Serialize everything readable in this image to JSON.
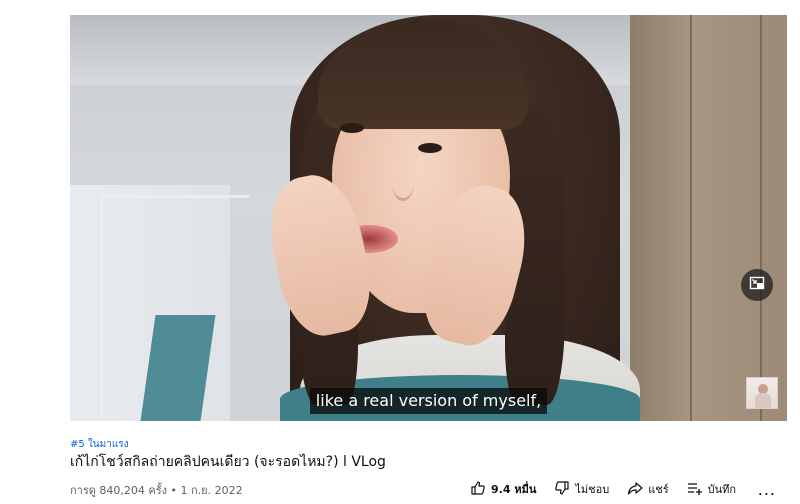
{
  "video": {
    "subtitle": "like a real version of myself,"
  },
  "meta": {
    "hashtag": "#5 ในมาแรง",
    "title": "เก้ไก่โชว์สกิลถ่ายคลิปคนเดียว (จะรอดไหม?) l VLog",
    "stats": "การดู 840,204 ครั้ง • 1 ก.ย. 2022"
  },
  "actions": {
    "like_count": "9.4 หมื่น",
    "dislike_label": "ไม่ชอบ",
    "share_label": "แชร์",
    "save_label": "บันทึก",
    "more_label": "..."
  },
  "icons": {
    "pip": "picture-in-picture-icon",
    "like": "thumbs-up-icon",
    "dislike": "thumbs-down-icon",
    "share": "share-arrow-icon",
    "save": "playlist-add-icon",
    "more": "more-horizontal-icon"
  },
  "colors": {
    "link": "#065fd4",
    "text": "#0f0f0f",
    "muted": "#606060"
  }
}
